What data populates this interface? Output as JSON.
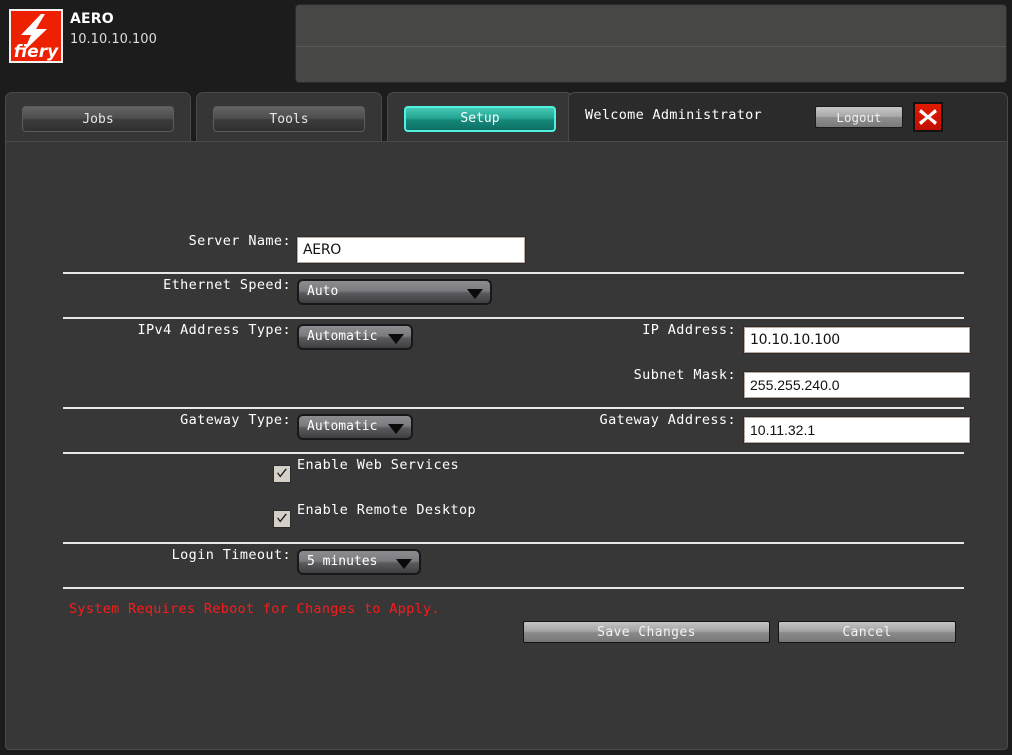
{
  "header": {
    "logo_alt": "fiery-logo",
    "logo_wordmark": "fiery",
    "server_name": "AERO",
    "server_ip": "10.10.10.100"
  },
  "tabs": [
    {
      "id": "jobs",
      "label": "Jobs",
      "active": false
    },
    {
      "id": "tools",
      "label": "Tools",
      "active": false
    },
    {
      "id": "setup",
      "label": "Setup",
      "active": true
    }
  ],
  "session": {
    "welcome": "Welcome Administrator",
    "logout_label": "Logout",
    "close_label": "Close"
  },
  "form": {
    "server_name": {
      "label": "Server Name:",
      "value": "AERO",
      "placeholder": ""
    },
    "ethernet_speed": {
      "label": "Ethernet Speed:",
      "value": "Auto"
    },
    "ipv4_address_type": {
      "label": "IPv4 Address Type:",
      "value": "Automatic"
    },
    "ip_address": {
      "label": "IP Address:",
      "value": "10.10.10.100",
      "placeholder": ""
    },
    "subnet_mask": {
      "label": "Subnet Mask:",
      "value": "255.255.240.0",
      "placeholder": ""
    },
    "gateway_type": {
      "label": "Gateway Type:",
      "value": "Automatic"
    },
    "gateway_address": {
      "label": "Gateway Address:",
      "value": "10.11.32.1",
      "placeholder": ""
    },
    "enable_web_services": {
      "label": "Enable Web Services",
      "checked": true
    },
    "enable_remote_desktop": {
      "label": "Enable Remote Desktop",
      "checked": true
    },
    "login_timeout": {
      "label": "Login Timeout:",
      "value": "5 minutes"
    }
  },
  "messages": {
    "reboot_warning": "System Requires Reboot for Changes to Apply."
  },
  "actions": {
    "save_label": "Save Changes",
    "cancel_label": "Cancel"
  },
  "colors": {
    "brand_red": "#ed2000",
    "accent_teal": "#25a694",
    "accent_teal_border": "#4ff2dd",
    "warning_red": "#ff1a1a",
    "page_bg": "#373737",
    "chrome_bg": "#1c1c1c"
  }
}
